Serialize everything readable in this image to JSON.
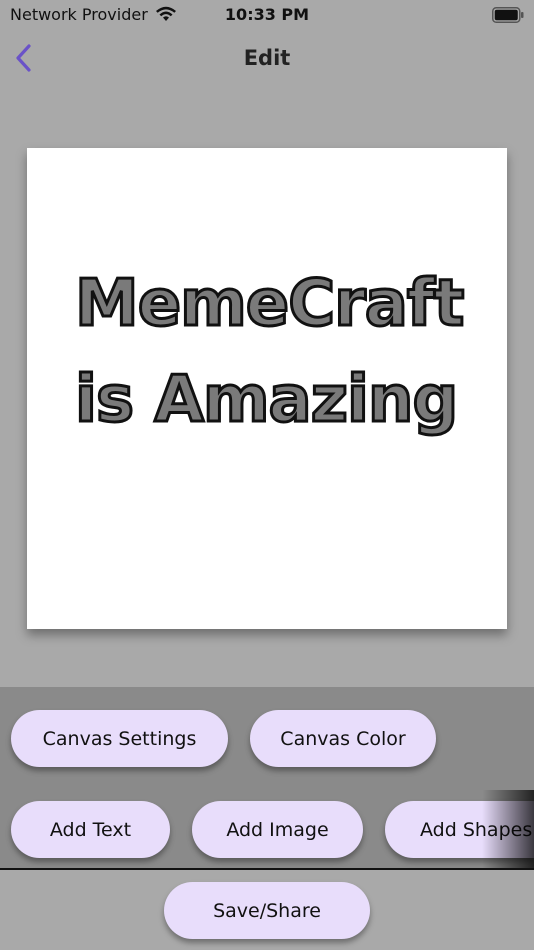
{
  "status_bar": {
    "carrier": "Network Provider",
    "time": "10:33 PM",
    "wifi_icon": "wifi-icon",
    "battery_icon": "battery-icon"
  },
  "nav": {
    "title": "Edit",
    "back_icon": "chevron-left-icon",
    "accent_color": "#6a52c8"
  },
  "canvas": {
    "background": "#ffffff",
    "text_line_1": "MemeCraft",
    "text_line_2": "is Amazing"
  },
  "tools": {
    "row1": [
      "Canvas Settings",
      "Canvas Color"
    ],
    "row2": [
      "Add Text",
      "Add Image",
      "Add Shapes"
    ],
    "button_color": "#e8ddfb"
  },
  "footer": {
    "save_label": "Save/Share"
  }
}
